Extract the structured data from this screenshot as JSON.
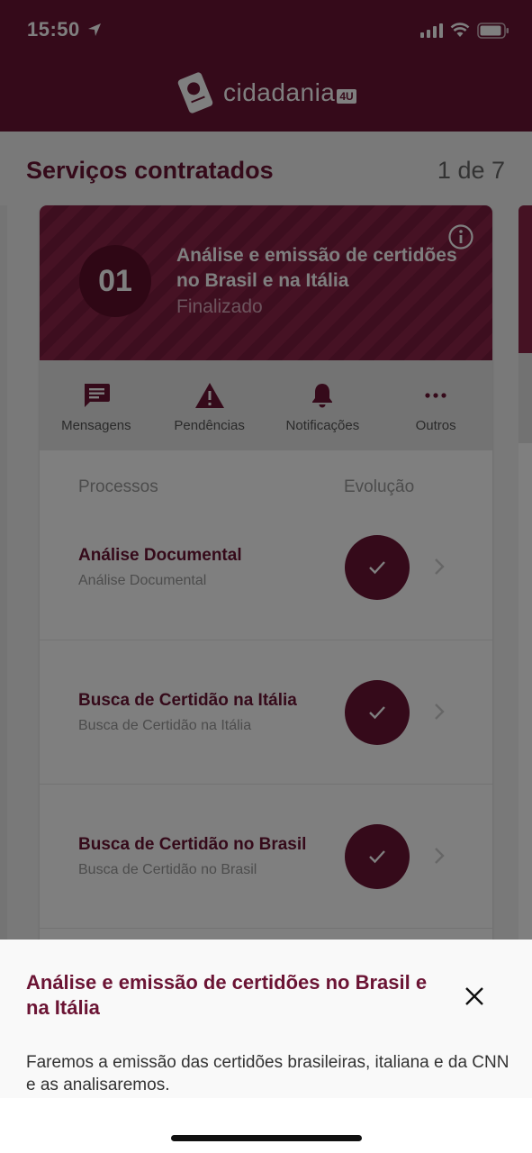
{
  "status_bar": {
    "time": "15:50"
  },
  "brand": {
    "name": "cidadania",
    "badge": "4U"
  },
  "page": {
    "title": "Serviços contratados",
    "pager": "1 de 7"
  },
  "service_card": {
    "number": "01",
    "title": "Análise e emissão de certidões no Brasil e na Itália",
    "status": "Finalizado",
    "actions": [
      {
        "label": "Mensagens",
        "icon": "message-icon"
      },
      {
        "label": "Pendências",
        "icon": "warning-icon"
      },
      {
        "label": "Notificações",
        "icon": "bell-icon"
      },
      {
        "label": "Outros",
        "icon": "more-icon"
      }
    ],
    "processes_header": {
      "name": "Processos",
      "progress": "Evolução"
    },
    "processes": [
      {
        "title": "Análise Documental",
        "subtitle": "Análise Documental"
      },
      {
        "title": "Busca de Certidão na Itália",
        "subtitle": "Busca de Certidão na Itália"
      },
      {
        "title": "Busca de Certidão no Brasil",
        "subtitle": "Busca de Certidão no Brasil"
      }
    ]
  },
  "sheet": {
    "title": "Análise e emissão de certidões no Brasil e na Itália",
    "text": "Faremos a emissão das certidões brasileiras, italiana e da CNN e as analisaremos."
  },
  "colors": {
    "brand": "#6b1434",
    "accent_light": "#d9a9bb"
  }
}
